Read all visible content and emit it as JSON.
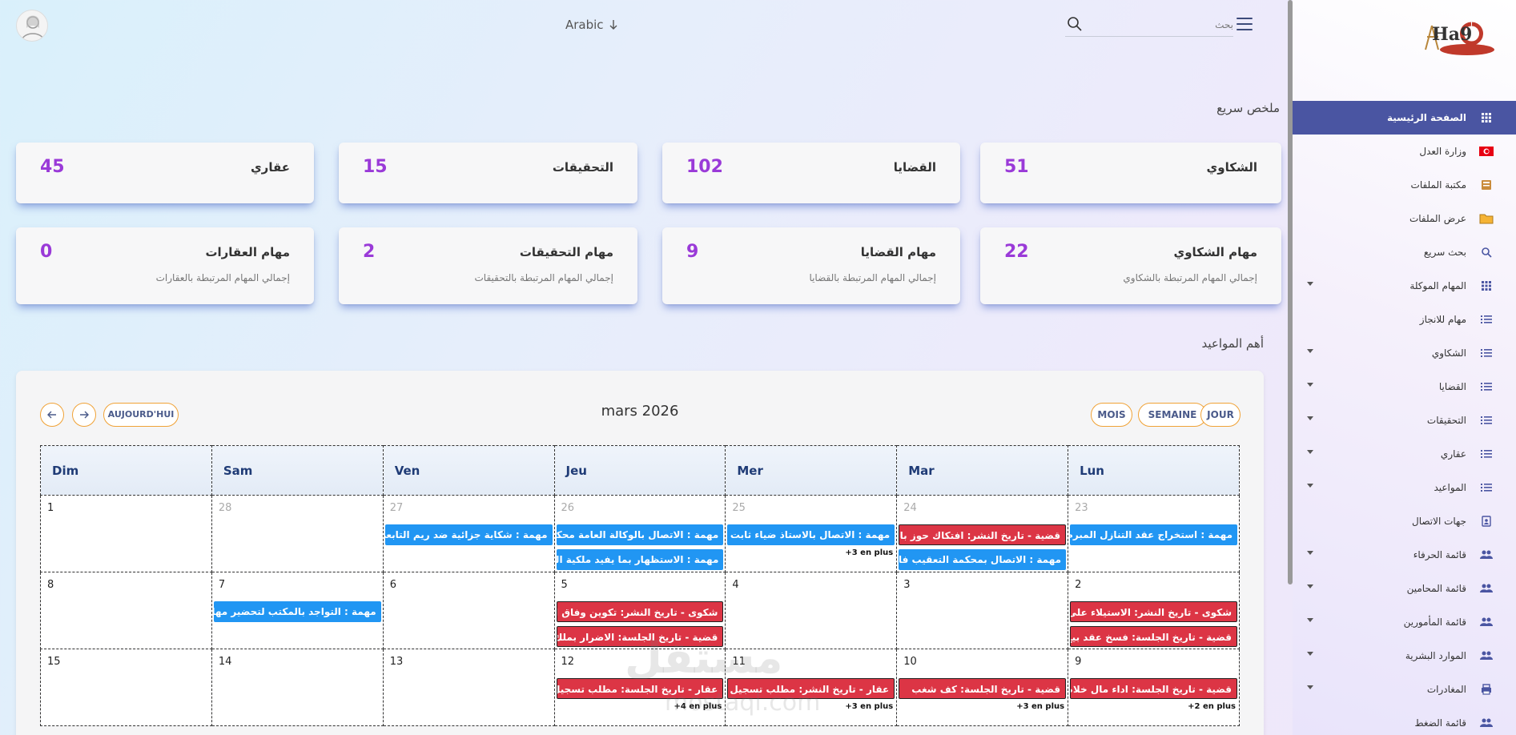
{
  "topbar": {
    "language": "Arabic",
    "search_label": "بحث",
    "search_placeholder": ""
  },
  "sections": {
    "summary_title": "ملخص سريع",
    "appointments_title": "أهم المواعيد"
  },
  "cards_row1": [
    {
      "label": "الشكاوي",
      "value": "51"
    },
    {
      "label": "القضايا",
      "value": "102"
    },
    {
      "label": "التحقيقات",
      "value": "15"
    },
    {
      "label": "عقاري",
      "value": "45"
    }
  ],
  "cards_row2": [
    {
      "label": "مهام الشكاوي",
      "value": "22",
      "sub": "إجمالي المهام المرتبطة بالشكاوي"
    },
    {
      "label": "مهام القضايا",
      "value": "9",
      "sub": "إجمالي المهام المرتبطة بالقضايا"
    },
    {
      "label": "مهام التحقيقات",
      "value": "2",
      "sub": "إجمالي المهام المرتبطة بالتحقيقات"
    },
    {
      "label": "مهام العقارات",
      "value": "0",
      "sub": "إجمالي المهام المرتبطة بالعقارات"
    }
  ],
  "calendar": {
    "title": "mars 2026",
    "today_label": "AUJOURD'HUI",
    "view_month": "MOIS",
    "view_week": "SEMAINE",
    "view_day": "JOUR",
    "weekdays": [
      "Dim",
      "Sam",
      "Ven",
      "Jeu",
      "Mer",
      "Mar",
      "Lun"
    ],
    "weeks": [
      {
        "days": [
          {
            "num": "1",
            "muted": false,
            "events": []
          },
          {
            "num": "28",
            "muted": true,
            "events": []
          },
          {
            "num": "27",
            "muted": true,
            "events": [
              {
                "text": "مهمة : شكاية جزائية ضد ريم التابعي عد",
                "color": "blue"
              }
            ]
          },
          {
            "num": "26",
            "muted": true,
            "events": [
              {
                "text": "مهمة : الاتصال بالوكالة العامة محكمة الا",
                "color": "blue"
              },
              {
                "text": "مهمة : الاستظهار بما يفيد ملكية الشركة",
                "color": "blue"
              }
            ]
          },
          {
            "num": "25",
            "muted": true,
            "events": [
              {
                "text": "مهمة : الاتصال بالاستاذ ضياء ثابت حول",
                "color": "blue"
              }
            ],
            "more": "+3 en plus"
          },
          {
            "num": "24",
            "muted": true,
            "events": [
              {
                "text": "قضية - تاريخ النشر: افتكاك حوز بالقوة",
                "color": "red"
              },
              {
                "text": "مهمة : الاتصال بمحكمة التعقيب فالقضية",
                "color": "blue"
              }
            ]
          },
          {
            "num": "23",
            "muted": true,
            "events": [
              {
                "text": "مهمة : استخراج عقد التنازل المبرم بين",
                "color": "blue"
              }
            ]
          }
        ]
      },
      {
        "days": [
          {
            "num": "8",
            "muted": false,
            "events": []
          },
          {
            "num": "7",
            "muted": false,
            "events": [
              {
                "text": "مهمة : التواجد بالمكتب لتحضير مهام الا",
                "color": "blue"
              }
            ]
          },
          {
            "num": "6",
            "muted": false,
            "events": []
          },
          {
            "num": "5",
            "muted": false,
            "events": [
              {
                "text": "شكوى - تاريخ النشر: تكوين وفاق اجرام",
                "color": "red"
              },
              {
                "text": "قضية - تاريخ الجلسة: الاضرار بملك الغير",
                "color": "red"
              }
            ]
          },
          {
            "num": "4",
            "muted": false,
            "events": []
          },
          {
            "num": "3",
            "muted": false,
            "events": []
          },
          {
            "num": "2",
            "muted": false,
            "events": [
              {
                "text": "شكوى - تاريخ النشر: الاستيلاء على ملك",
                "color": "red"
              },
              {
                "text": "قضية - تاريخ الجلسة: فسخ عقد بيع",
                "color": "red"
              }
            ]
          }
        ]
      },
      {
        "days": [
          {
            "num": "15",
            "muted": false,
            "events": []
          },
          {
            "num": "14",
            "muted": false,
            "events": []
          },
          {
            "num": "13",
            "muted": false,
            "events": []
          },
          {
            "num": "12",
            "muted": false,
            "events": [
              {
                "text": "عقار - تاريخ الجلسة: مطلب تسجيل عقد",
                "color": "red"
              }
            ],
            "more": "+4 en plus"
          },
          {
            "num": "11",
            "muted": false,
            "events": [
              {
                "text": "عقار - تاريخ النشر: مطلب تسجيل عقد",
                "color": "red"
              }
            ],
            "more": "+3 en plus"
          },
          {
            "num": "10",
            "muted": false,
            "events": [
              {
                "text": "قضية - تاريخ الجلسة: كف شغب",
                "color": "red"
              }
            ],
            "more": "+3 en plus"
          },
          {
            "num": "9",
            "muted": false,
            "events": [
              {
                "text": "قضية - تاريخ الجلسة: اداء مال خلاص كر",
                "color": "red"
              }
            ],
            "more": "+2 en plus"
          }
        ]
      }
    ]
  },
  "sidebar": {
    "logo_text": "Ha9",
    "items": [
      {
        "label": "الصفحة الرئيسية",
        "icon": "grid-icon",
        "active": true,
        "caret": false
      },
      {
        "label": "وزارة العدل",
        "icon": "flag-icon",
        "active": false,
        "caret": false
      },
      {
        "label": "مكتبة الملفات",
        "icon": "book-icon",
        "active": false,
        "caret": false
      },
      {
        "label": "عرض الملفات",
        "icon": "folder-icon",
        "active": false,
        "caret": false
      },
      {
        "label": "بحث سريع",
        "icon": "search-icon",
        "active": false,
        "caret": false
      },
      {
        "label": "المهام الموكلة",
        "icon": "grid-icon",
        "active": false,
        "caret": true
      },
      {
        "label": "مهام للانجاز",
        "icon": "list-icon",
        "active": false,
        "caret": false
      },
      {
        "label": "الشكاوي",
        "icon": "list-icon",
        "active": false,
        "caret": true
      },
      {
        "label": "القضايا",
        "icon": "list-icon",
        "active": false,
        "caret": true
      },
      {
        "label": "التحقيقات",
        "icon": "list-icon",
        "active": false,
        "caret": true
      },
      {
        "label": "عقاري",
        "icon": "list-icon",
        "active": false,
        "caret": true
      },
      {
        "label": "المواعيد",
        "icon": "list-icon",
        "active": false,
        "caret": true
      },
      {
        "label": "جهات الاتصال",
        "icon": "contact-icon",
        "active": false,
        "caret": false
      },
      {
        "label": "قائمة الحرفاء",
        "icon": "users-icon",
        "active": false,
        "caret": true
      },
      {
        "label": "قائمة المحامين",
        "icon": "users-icon",
        "active": false,
        "caret": true
      },
      {
        "label": "قائمة المأمورين",
        "icon": "users-icon",
        "active": false,
        "caret": true
      },
      {
        "label": "الموارد البشرية",
        "icon": "users-icon",
        "active": false,
        "caret": true
      },
      {
        "label": "المغادرات",
        "icon": "print-icon",
        "active": false,
        "caret": true
      },
      {
        "label": "قائمة الضغط",
        "icon": "users-icon",
        "active": false,
        "caret": false
      }
    ]
  },
  "colors": {
    "accent_purple": "#9a3ad8",
    "sidebar_active": "#4a55a2",
    "event_blue": "#2196f3",
    "event_red": "#dc3545",
    "pill_border": "#f0a236"
  }
}
